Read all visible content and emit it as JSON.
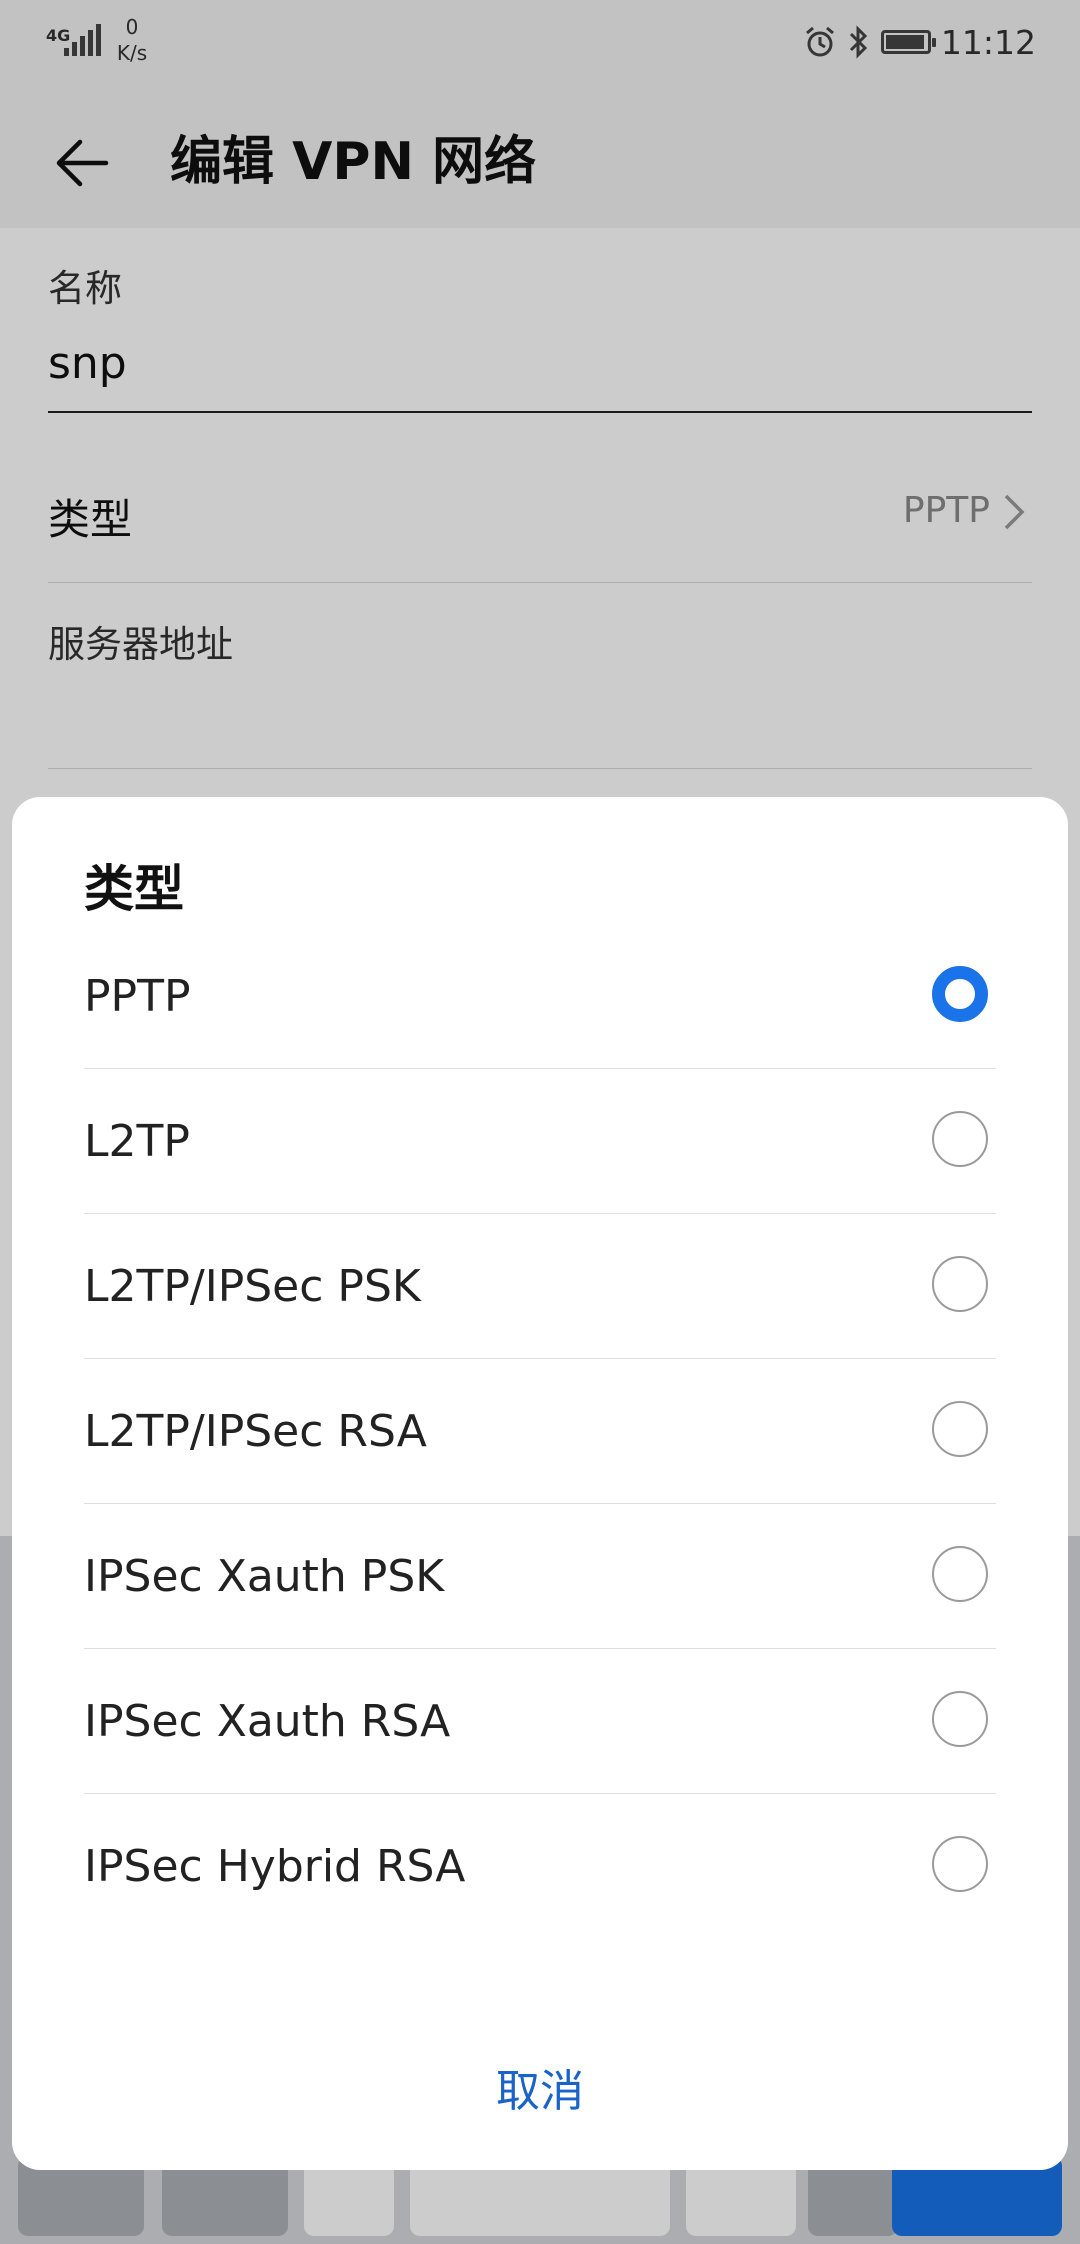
{
  "status_bar": {
    "network": "4G",
    "speed_value": "0",
    "speed_unit": "K/s",
    "time": "11:12",
    "icons": [
      "signal-icon",
      "alarm-icon",
      "bluetooth-icon",
      "battery-icon"
    ]
  },
  "app_bar": {
    "title": "编辑 VPN 网络",
    "back_icon": "back-arrow-icon"
  },
  "form": {
    "name_label": "名称",
    "name_value": "snp",
    "type_label": "类型",
    "type_value": "PPTP",
    "server_label": "服务器地址"
  },
  "dialog": {
    "title": "类型",
    "options": [
      {
        "label": "PPTP",
        "selected": true
      },
      {
        "label": "L2TP",
        "selected": false
      },
      {
        "label": "L2TP/IPSec PSK",
        "selected": false
      },
      {
        "label": "L2TP/IPSec RSA",
        "selected": false
      },
      {
        "label": "IPSec Xauth PSK",
        "selected": false
      },
      {
        "label": "IPSec Xauth RSA",
        "selected": false
      },
      {
        "label": "IPSec Hybrid RSA",
        "selected": false
      }
    ],
    "cancel_label": "取消"
  },
  "colors": {
    "accent": "#1a73e8",
    "cancel_text": "#1a63c9",
    "scrim": "rgba(0,0,0,0.20)"
  }
}
